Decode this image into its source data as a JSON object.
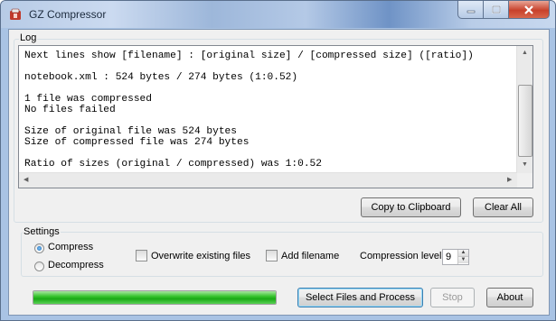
{
  "window": {
    "title": "GZ Compressor",
    "icons": {
      "app": "gz-app-icon",
      "minimize": "minimize-icon",
      "maximize": "maximize-icon",
      "close": "close-icon"
    }
  },
  "log": {
    "group_label": "Log",
    "lines": [
      "Next lines show [filename] : [original size] / [compressed size] ([ratio])",
      "",
      "notebook.xml : 524 bytes / 274 bytes (1:0.52)",
      "",
      "1 file was compressed",
      "No files failed",
      "",
      "Size of original file was 524 bytes",
      "Size of compressed file was 274 bytes",
      "",
      "Ratio of sizes (original / compressed) was 1:0.52"
    ],
    "copy_button": "Copy to Clipboard",
    "clear_button": "Clear All"
  },
  "settings": {
    "group_label": "Settings",
    "mode_options": [
      {
        "label": "Compress",
        "selected": true
      },
      {
        "label": "Decompress",
        "selected": false
      }
    ],
    "overwrite": {
      "label": "Overwrite existing files",
      "checked": false
    },
    "add_filename": {
      "label": "Add filename",
      "checked": false
    },
    "compression_level": {
      "label": "Compression level",
      "value": "9"
    }
  },
  "actions": {
    "progress_percent": 100,
    "select_button": "Select Files and Process",
    "stop_button": "Stop",
    "about_button": "About"
  },
  "colors": {
    "progress": "#1fb21a",
    "accent": "#3c7fb1"
  }
}
